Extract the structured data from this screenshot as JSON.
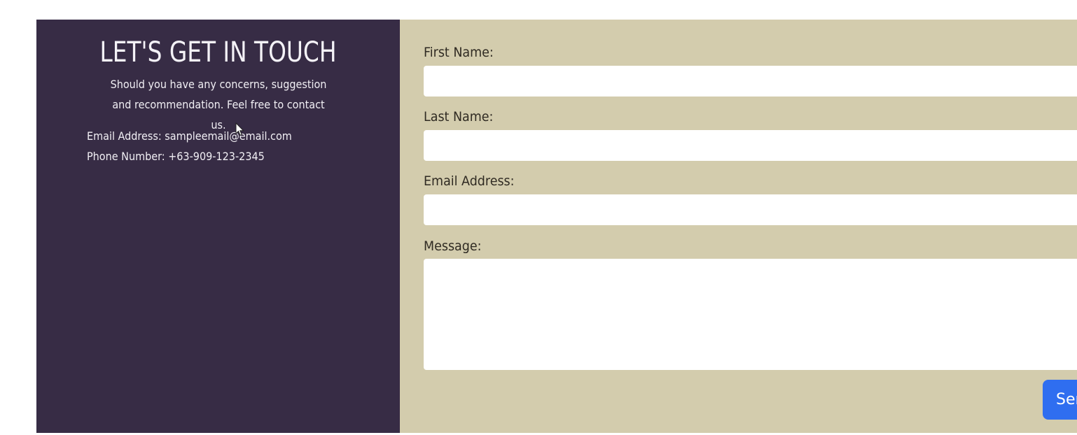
{
  "info": {
    "title": "LET'S GET IN TOUCH",
    "subtitle": "Should you have any concerns, suggestion and recommendation. Feel free to contact us.",
    "email_line": "Email Address: sampleemail@email.com",
    "phone_line": "Phone Number: +63-909-123-2345"
  },
  "form": {
    "first_name_label": "First Name:",
    "first_name_value": "",
    "last_name_label": "Last Name:",
    "last_name_value": "",
    "email_label": "Email Address:",
    "email_value": "",
    "message_label": "Message:",
    "message_value": "",
    "send_label": "Send"
  },
  "colors": {
    "info_panel_bg": "#372c45",
    "form_panel_bg": "#d3ccad",
    "button_bg": "#2f6ef0"
  }
}
